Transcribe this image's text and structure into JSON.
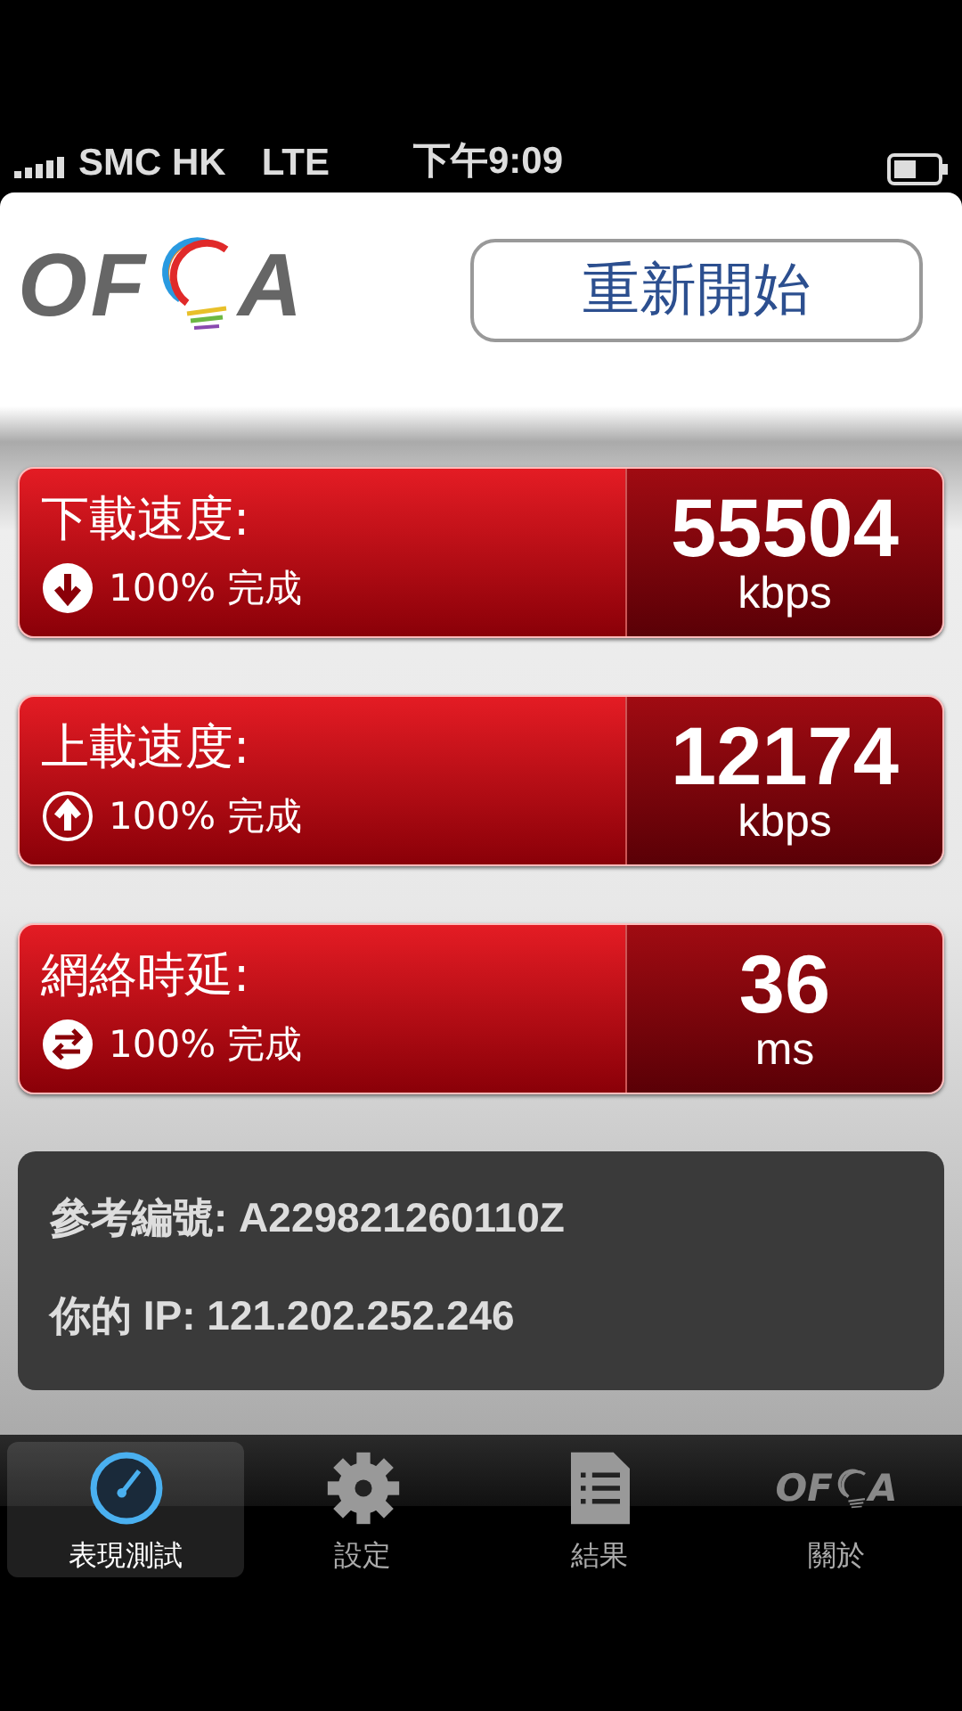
{
  "status_bar": {
    "carrier": "SMC HK",
    "network": "LTE",
    "time": "下午9:09"
  },
  "header": {
    "logo": {
      "left": "OF",
      "right": "A"
    },
    "restart_button": "重新開始"
  },
  "metrics": [
    {
      "title": "下載速度:",
      "kind": "download",
      "progress": "100% 完成",
      "value": "55504",
      "unit": "kbps"
    },
    {
      "title": "上載速度:",
      "kind": "upload",
      "progress": "100% 完成",
      "value": "12174",
      "unit": "kbps"
    },
    {
      "title": "網絡時延:",
      "kind": "latency",
      "progress": "100% 完成",
      "value": "36",
      "unit": "ms"
    }
  ],
  "info": [
    {
      "label": "參考編號:",
      "value": "A229821260110Z"
    },
    {
      "label": "你的 IP:",
      "value": "121.202.252.246"
    }
  ],
  "tabs": [
    {
      "label": "表現測試",
      "kind": "gauge",
      "selected": true
    },
    {
      "label": "設定",
      "kind": "gear",
      "selected": false
    },
    {
      "label": "結果",
      "kind": "document",
      "selected": false
    },
    {
      "label": "關於",
      "kind": "logo",
      "logo": {
        "left": "OF",
        "right": "A"
      },
      "selected": false
    }
  ]
}
